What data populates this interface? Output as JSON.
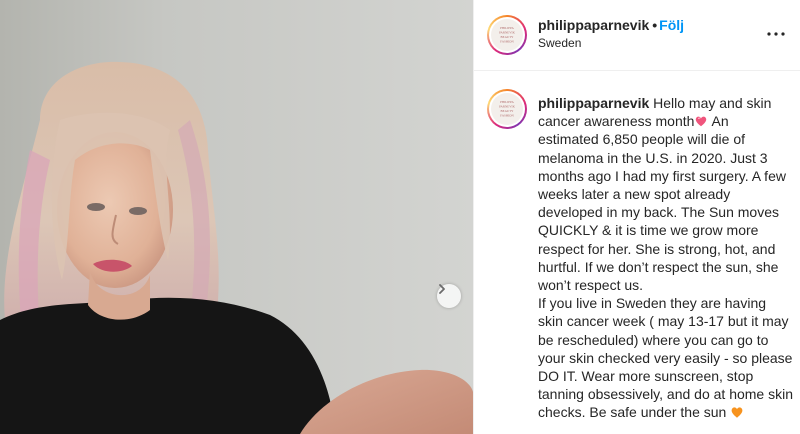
{
  "post": {
    "username": "philippaparnevik",
    "separator": "•",
    "follow_label": "Följ",
    "location": "Sweden",
    "more_icon": "more-horizontal-icon"
  },
  "avatar": {
    "logo_lines": [
      "PHILIPPA",
      "PARNEVIK",
      "BEAUTY",
      "FASHION"
    ]
  },
  "caption": {
    "username": "philippaparnevik",
    "text_part1": " Hello may and skin cancer awareness month",
    "emoji1": "sparkling-heart-emoji",
    "text_part2": " An estimated 6,850 people will die of melanoma in the U.S. in 2020. Just 3 months ago I had my first surgery. A few weeks later a new spot already developed in my back. The Sun moves QUICKLY & it is time we grow more respect for her. She is strong, hot, and hurtful. If we don’t respect the sun, she won’t respect us.",
    "text_part3": "If you live in Sweden they are having skin cancer week ( may 13-17 but it may be rescheduled) where you can go to your skin checked very easily - so please DO IT. Wear more sunscreen, stop tanning obsessively, and do at home skin checks. Be safe under the sun ",
    "emoji2": "orange-heart-emoji"
  },
  "media": {
    "next_icon": "chevron-right-icon",
    "colors": {
      "wall": "#cfd0cd",
      "shirt": "#151515",
      "hair": "#d7c0b0",
      "hair_pink": "#d9a6b8",
      "skin": "#e6bfa6",
      "lips": "#c8546a"
    }
  },
  "theme": {
    "link_color": "#0095f6",
    "text_color": "#262626",
    "border_color": "#efefef"
  }
}
